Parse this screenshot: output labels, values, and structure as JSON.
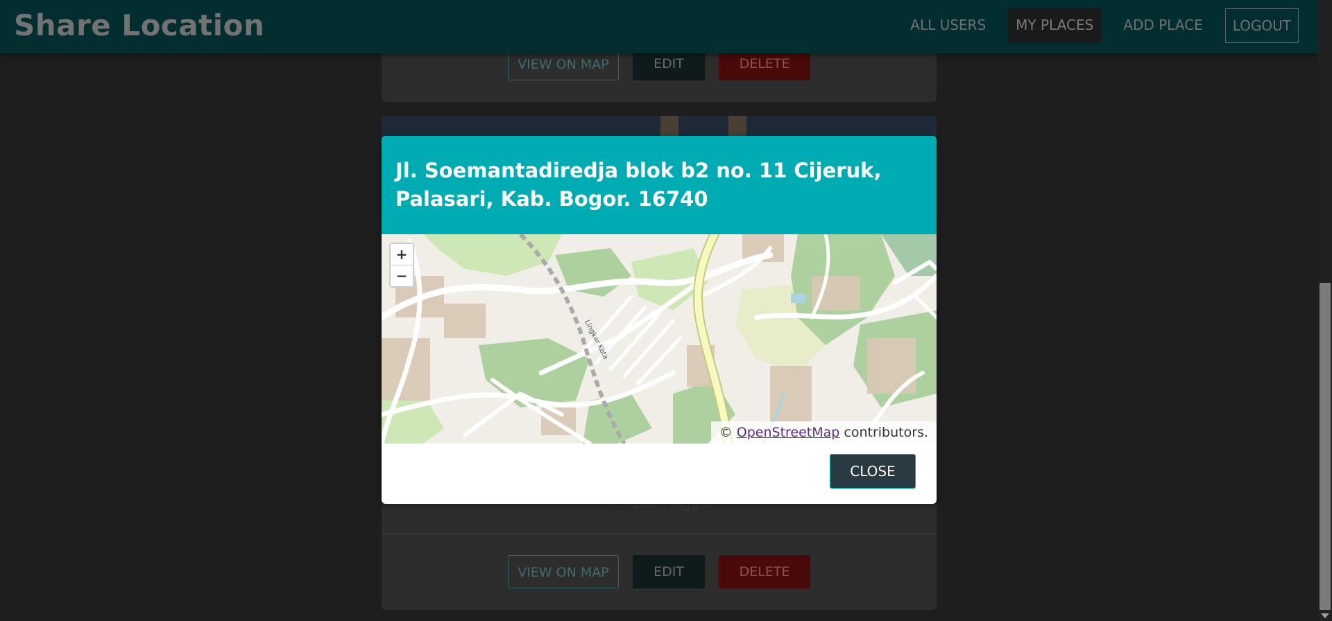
{
  "header": {
    "brand": "Share Location",
    "nav": [
      "ALL USERS",
      "MY PLACES",
      "ADD PLACE"
    ],
    "logout": "LOGOUT",
    "active_nav": "MY PLACES"
  },
  "places": [
    {
      "actions": {
        "view": "VIEW ON MAP",
        "edit": "EDIT",
        "delete": "DELETE"
      }
    },
    {
      "description": "Tempat Tinggal",
      "actions": {
        "view": "VIEW ON MAP",
        "edit": "EDIT",
        "delete": "DELETE"
      }
    }
  ],
  "modal": {
    "title": "Jl. Soemantadiredja blok b2 no. 11 Cijeruk, Palasari, Kab. Bogor. 16740",
    "map": {
      "zoom_in": "+",
      "zoom_out": "−",
      "road_label": "Lingkar Kota",
      "attribution_prefix": "©",
      "attribution_link": "OpenStreetMap",
      "attribution_suffix": "contributors."
    },
    "close_label": "CLOSE"
  },
  "colors": {
    "modal_header": "#00acb4",
    "close_button": "#2a3a42",
    "header_bg": "#022e30"
  }
}
